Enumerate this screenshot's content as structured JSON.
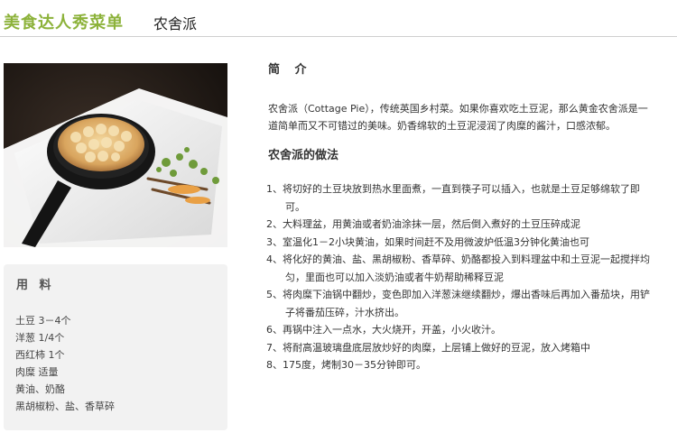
{
  "header": {
    "site_title": "美食达人秀菜单",
    "dish_title": "农舍派"
  },
  "photo": {
    "description_icon": "cottage-pie-photo"
  },
  "ingredients": {
    "title": "用 料",
    "items": [
      "土豆 3－4个",
      "洋葱 1/4个",
      "西红柿 1个",
      "肉糜 适量",
      "黄油、奶酪",
      "黑胡椒粉、盐、香草碎"
    ]
  },
  "intro": {
    "title": "简 介",
    "text": "农舍派（Cottage Pie），传统英国乡村菜。如果你喜欢吃土豆泥，那么黄金农舍派是一道简单而又不可错过的美味。奶香绵软的土豆泥浸润了肉糜的酱汁，口感浓郁。"
  },
  "method": {
    "title": "农舍派的做法",
    "steps": [
      "1、将切好的土豆块放到热水里面煮，一直到筷子可以插入，也就是土豆足够绵软了即可。",
      "2、大料理盆，用黄油或者奶油涂抹一层，然后倒入煮好的土豆压碎成泥",
      "3、室温化1－2小块黄油，如果时间赶不及用微波炉低温3分钟化黄油也可",
      "4、将化好的黄油、盐、黑胡椒粉、香草碎、奶酪都投入到料理盆中和土豆泥一起搅拌均匀，里面也可以加入淡奶油或者牛奶帮助稀释豆泥",
      "5、将肉糜下油锅中翻炒，变色即加入洋葱沫继续翻炒，爆出香味后再加入番茄块，用铲子将番茄压碎，汁水挤出。",
      "6、再锅中注入一点水，大火烧开，开盖，小火收汁。",
      "7、将耐高温玻璃盘底层放炒好的肉糜，上层铺上做好的豆泥，放入烤箱中",
      "8、175度，烤制30－35分钟即可。"
    ]
  },
  "colors": {
    "brand_green": "#8cb23a",
    "panel_gray": "#f2f2f2"
  }
}
